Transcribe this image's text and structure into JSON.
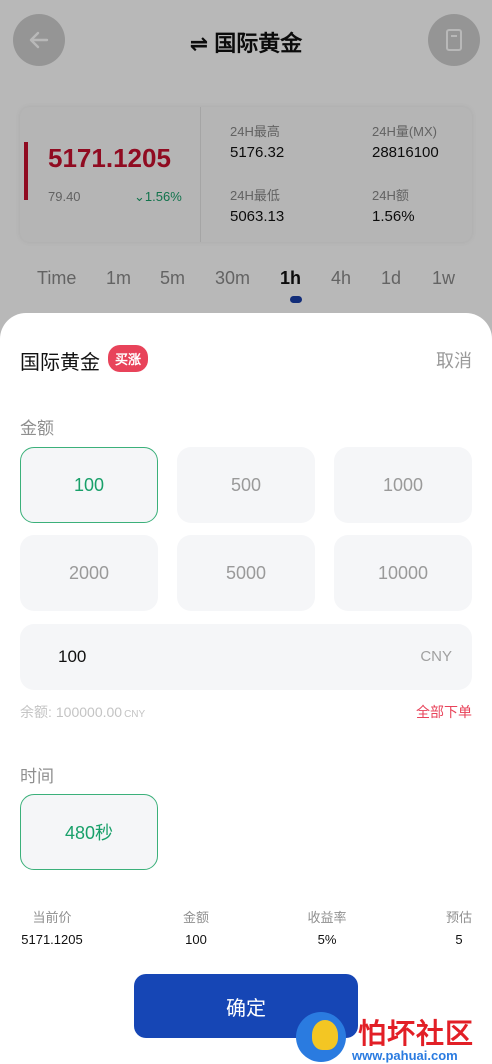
{
  "header": {
    "title": "国际黄金",
    "back_icon": "arrow-left-icon",
    "order_icon": "document-icon"
  },
  "quote": {
    "price": "5171.1205",
    "change": "79.40",
    "change_pct": "1.56%",
    "stats": [
      {
        "label": "24H最高",
        "value": "5176.32"
      },
      {
        "label": "24H量(MX)",
        "value": "28816100"
      },
      {
        "label": "24H最低",
        "value": "5063.13"
      },
      {
        "label": "24H额",
        "value": "1.56%"
      }
    ]
  },
  "time_tabs": [
    "Time",
    "1m",
    "5m",
    "30m",
    "1h",
    "4h",
    "1d",
    "1w"
  ],
  "time_tab_active": "1h",
  "sheet": {
    "title": "国际黄金",
    "direction_badge": "买涨",
    "cancel": "取消",
    "amount_label": "金额",
    "amounts": [
      "100",
      "500",
      "1000",
      "2000",
      "5000",
      "10000"
    ],
    "selected_amount": "100",
    "amount_input_value": "100",
    "amount_unit": "CNY",
    "balance_label": "余额:",
    "balance_value": "100000.00",
    "balance_unit": "CNY",
    "all_order": "全部下单",
    "time_label": "时间",
    "time_option": "480秒",
    "summary": [
      {
        "label": "当前价",
        "value": "5171.1205"
      },
      {
        "label": "金额",
        "value": "100"
      },
      {
        "label": "收益率",
        "value": "5%"
      },
      {
        "label": "预估",
        "value": "5"
      }
    ],
    "confirm": "确定"
  },
  "watermark": {
    "text": "怕坏社区",
    "url": "www.pahuai.com"
  },
  "colors": {
    "accent_red": "#c8102e",
    "accent_green": "#19a06a",
    "primary_blue": "#1646b5",
    "badge_red": "#e8435a"
  }
}
